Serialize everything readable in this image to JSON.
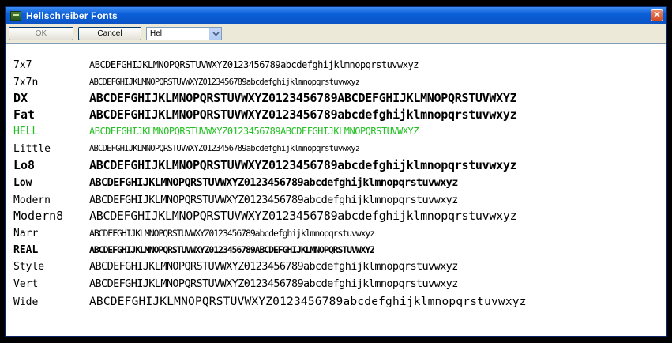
{
  "window": {
    "title": "Hellschreiber Fonts",
    "close_glyph": "✕"
  },
  "toolbar": {
    "ok_label": "OK",
    "cancel_label": "Cancel",
    "font_select_value": "Hel"
  },
  "fonts": [
    {
      "name": "7x7",
      "sample": "ABCDEFGHIJKLMNOPQRSTUVWXYZ0123456789abcdefghijklmnopqrstuvwxyz"
    },
    {
      "name": "7x7n",
      "sample": "ABCDEFGHIJKLMNOPQRSTUVWXYZ0123456789abcdefghijklmnopqrstuvwxyz"
    },
    {
      "name": "DX",
      "sample": "ABCDEFGHIJKLMNOPQRSTUVWXYZ0123456789ABCDEFGHIJKLMNOPQRSTUVWXYZ"
    },
    {
      "name": "Fat",
      "sample": "ABCDEFGHIJKLMNOPQRSTUVWXYZ0123456789abcdefghijklmnopqrstuvwxyz"
    },
    {
      "name": "HELL",
      "sample": "ABCDEFGHIJKLMNOPQRSTUVWXYZ0123456789ABCDEFGHIJKLMNOPQRSTUVWXYZ"
    },
    {
      "name": "Little",
      "sample": "ABCDEFGHIJKLMNOPQRSTUVWXYZ0123456789abcdefghijklmnopqrstuvwxyz"
    },
    {
      "name": "Lo8",
      "sample": "ABCDEFGHIJKLMNOPQRSTUVWXYZ0123456789abcdefghijklmnopqrstuvwxyz"
    },
    {
      "name": "Low",
      "sample": "ABCDEFGHIJKLMNOPQRSTUVWXYZ0123456789abcdefghijklmnopqrstuvwxyz"
    },
    {
      "name": "Modern",
      "sample": "ABCDEFGHIJKLMNOPQRSTUVWXYZ0123456789abcdefghijklmnopqrstuvwxyz"
    },
    {
      "name": "Modern8",
      "sample": "ABCDEFGHIJKLMNOPQRSTUVWXYZ0123456789abcdefghijklmnopqrstuvwxyz"
    },
    {
      "name": "Narr",
      "sample": "ABCDEFGHIJKLMNOPQRSTUVWXYZ0123456789abcdefghijklmnopqrstuvwxyz"
    },
    {
      "name": "REAL",
      "sample": "ABCDEFGHIJKLMNOPQRSTUVWXYZ0123456789ABCDEFGHIJKLMNOPQRSTUVWXYZ"
    },
    {
      "name": "Style",
      "sample": "ABCDEFGHIJKLMNOPQRSTUVWXYZ0123456789abcdefghijklmnopqrstuvwxyz"
    },
    {
      "name": "Vert",
      "sample": "ABCDEFGHIJKLMNOPQRSTUVWXYZ0123456789abcdefghijklmnopqrstuvwxyz"
    },
    {
      "name": "Wide",
      "sample": "ABCDEFGHIJKLMNOPQRSTUVWXYZ0123456789abcdefghijklmnopqrstuvwxyz"
    }
  ],
  "colors": {
    "titlebar": "#0a5fd8",
    "highlight_font": "#22c022",
    "text": "#000000"
  }
}
